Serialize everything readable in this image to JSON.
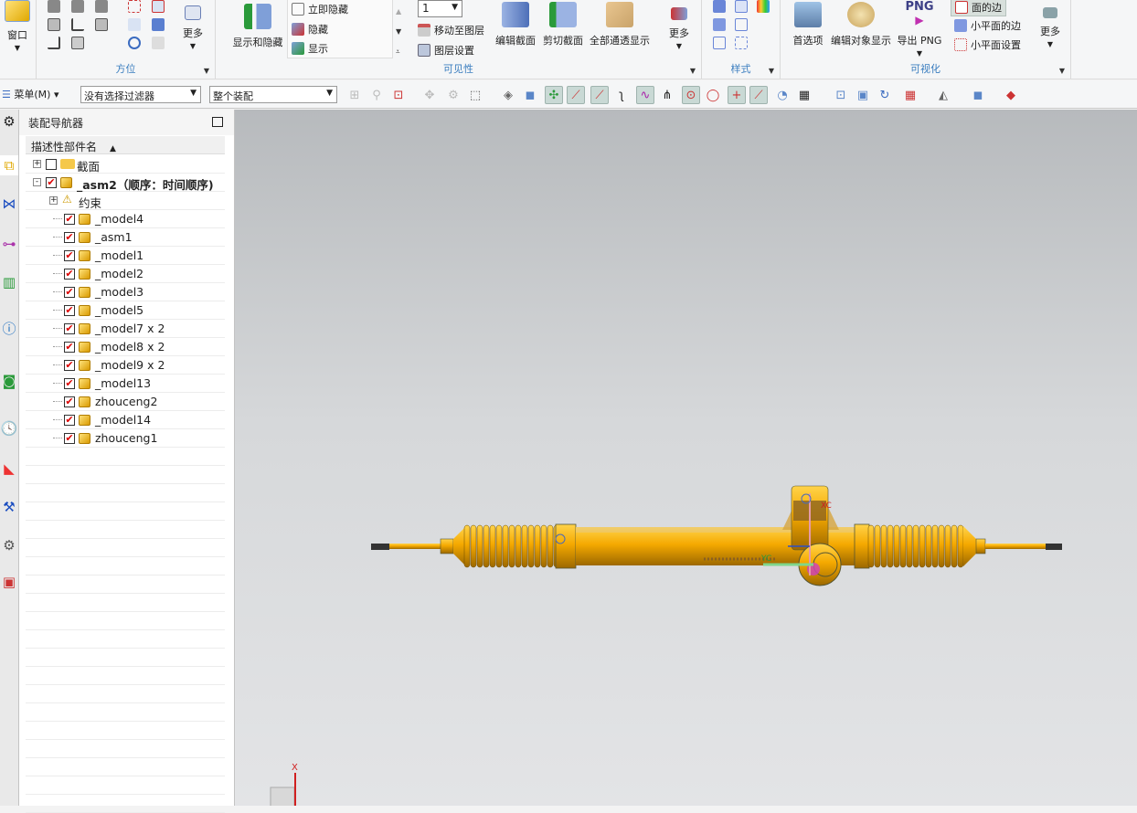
{
  "ribbon": {
    "window": {
      "label": "窗口"
    },
    "orientation": {
      "label": "方位",
      "more": "更多"
    },
    "visibility": {
      "label": "可见性",
      "show_hide": "显示和隐藏",
      "immediate_hide": "立即隐藏",
      "hide": "隐藏",
      "show": "显示",
      "layer_value": "1",
      "move_to_layer": "移动至图层",
      "layer_settings": "图层设置",
      "edit_section": "编辑截面",
      "clip_section": "剪切截面",
      "all_translucent": "全部通透显示",
      "more": "更多"
    },
    "style": {
      "label": "样式"
    },
    "visualization": {
      "label": "可视化",
      "preferences": "首选项",
      "edit_object_display": "编辑对象显示",
      "export_png": "导出 PNG",
      "png_badge": "PNG",
      "face_edges": "面的边",
      "facet_edges": "小平面的边",
      "facet_settings": "小平面设置",
      "more": "更多"
    }
  },
  "toolbar": {
    "menu": "菜单(M)",
    "filter": "没有选择过滤器",
    "scope": "整个装配"
  },
  "navigator": {
    "title": "装配导航器",
    "column": "描述性部件名",
    "items": [
      {
        "label": "截面",
        "level": 0,
        "checked": false,
        "icon": "folder-icon",
        "expander": "+"
      },
      {
        "label": "_asm2（顺序：时间顺序)",
        "level": 0,
        "checked": true,
        "icon": "assembly-icon",
        "expander": "-",
        "bold": true
      },
      {
        "label": "约束",
        "level": 1,
        "checked": null,
        "icon": "constraint-warning-icon",
        "expander": "+"
      },
      {
        "label": "_model4",
        "level": 2,
        "checked": true,
        "icon": "part-icon"
      },
      {
        "label": "_asm1",
        "level": 2,
        "checked": true,
        "icon": "part-icon"
      },
      {
        "label": "_model1",
        "level": 2,
        "checked": true,
        "icon": "part-icon"
      },
      {
        "label": "_model2",
        "level": 2,
        "checked": true,
        "icon": "part-icon"
      },
      {
        "label": "_model3",
        "level": 2,
        "checked": true,
        "icon": "part-icon"
      },
      {
        "label": "_model5",
        "level": 2,
        "checked": true,
        "icon": "part-icon"
      },
      {
        "label": "_model7 x 2",
        "level": 2,
        "checked": true,
        "icon": "part-icon"
      },
      {
        "label": "_model8 x 2",
        "level": 2,
        "checked": true,
        "icon": "part-icon"
      },
      {
        "label": "_model9 x 2",
        "level": 2,
        "checked": true,
        "icon": "part-icon"
      },
      {
        "label": "_model13",
        "level": 2,
        "checked": true,
        "icon": "part-icon"
      },
      {
        "label": "zhouceng2",
        "level": 2,
        "checked": true,
        "icon": "part-icon"
      },
      {
        "label": "_model14",
        "level": 2,
        "checked": true,
        "icon": "part-icon"
      },
      {
        "label": "zhouceng1",
        "level": 2,
        "checked": true,
        "icon": "part-icon"
      }
    ]
  },
  "viewport": {
    "axis_x": "X",
    "wcs_xc": "XC",
    "wcs_yc": "YC",
    "model_color": "#f0a800"
  }
}
